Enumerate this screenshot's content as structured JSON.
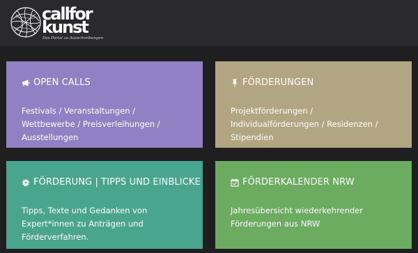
{
  "header": {
    "logo": {
      "line1": "callfor",
      "line2": "kunst",
      "tagline": "Das Portal zu Ausschreibungen"
    }
  },
  "tiles": [
    {
      "title": "OPEN CALLS",
      "icon": "megaphone-icon",
      "text": "Festivals / Veranstaltungen / Wettbewerbe / Preisverleihungen / Ausstellungen",
      "color": "#9181c4"
    },
    {
      "title": "FÖRDERUNGEN",
      "icon": "pushpin-icon",
      "text": "Projektförderungen / Individualförderungen / Residenzen / Stipendien",
      "color": "#b1a681"
    },
    {
      "title": "FÖRDERUNG | TIPPS UND EINBLICKE",
      "icon": "burst-icon",
      "text": "Tipps, Texte und Gedanken von Expert*innen zu Anträgen und Förderverfahren.",
      "color": "#4aa58e"
    },
    {
      "title": "FÖRDERKALENDER NRW",
      "icon": "calendar-check-icon",
      "text": "Jahresübersicht wiederkehrender Förderungen aus NRW",
      "color": "#6bac61"
    }
  ],
  "colors": {
    "background": "#1f1f21",
    "header": "#2a2a2c"
  }
}
